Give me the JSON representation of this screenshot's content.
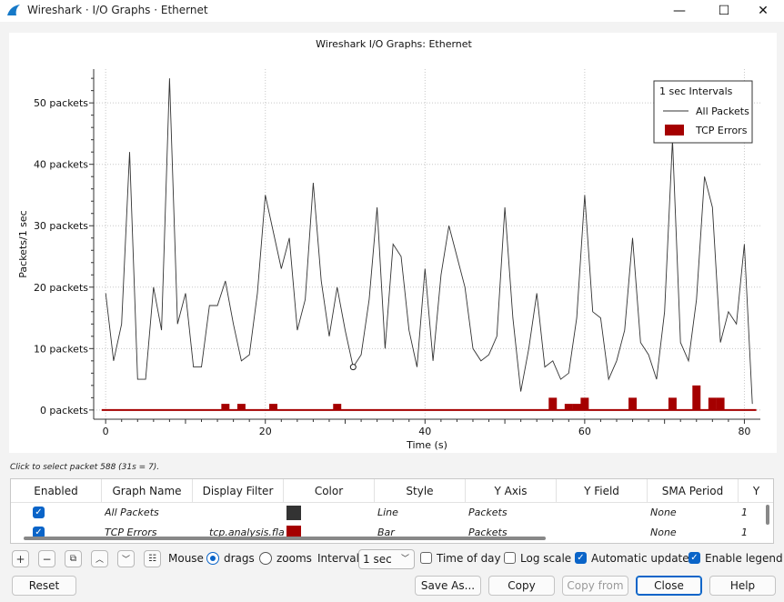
{
  "window": {
    "title": "Wireshark · I/O Graphs · Ethernet",
    "minimize": "—",
    "maximize": "☐",
    "close": "✕"
  },
  "chart_data": {
    "type": "line",
    "title": "Wireshark I/O Graphs: Ethernet",
    "xlabel": "Time (s)",
    "ylabel": "Packets/1 sec",
    "xlim": [
      -1.5,
      82
    ],
    "ylim": [
      -1.5,
      55.5
    ],
    "xticks": [
      0,
      20,
      40,
      60,
      80
    ],
    "xtick_labels": [
      "0",
      "20",
      "40",
      "60",
      "80"
    ],
    "yticks": [
      0,
      10,
      20,
      30,
      40,
      50
    ],
    "ytick_labels": [
      "0 packets",
      "10 packets",
      "20 packets",
      "30 packets",
      "40 packets",
      "50 packets"
    ],
    "grid": true,
    "legend": {
      "header": "1 sec Intervals",
      "placement": "top-right"
    },
    "series": [
      {
        "name": "All Packets",
        "style": "line",
        "color": "#333333",
        "x": [
          0,
          1,
          2,
          3,
          4,
          5,
          6,
          7,
          8,
          9,
          10,
          11,
          12,
          13,
          14,
          15,
          16,
          17,
          18,
          19,
          20,
          21,
          22,
          23,
          24,
          25,
          26,
          27,
          28,
          29,
          30,
          31,
          32,
          33,
          34,
          35,
          36,
          37,
          38,
          39,
          40,
          41,
          42,
          43,
          44,
          45,
          46,
          47,
          48,
          49,
          50,
          51,
          52,
          53,
          54,
          55,
          56,
          57,
          58,
          59,
          60,
          61,
          62,
          63,
          64,
          65,
          66,
          67,
          68,
          69,
          70,
          71,
          72,
          73,
          74,
          75,
          76,
          77,
          78,
          79,
          80,
          81
        ],
        "y": [
          19,
          8,
          14,
          42,
          5,
          5,
          20,
          13,
          54,
          14,
          19,
          7,
          7,
          17,
          17,
          21,
          14,
          8,
          9,
          19,
          35,
          29,
          23,
          28,
          13,
          18,
          37,
          21,
          12,
          20,
          13,
          7,
          9,
          18,
          33,
          10,
          27,
          25,
          13,
          7,
          23,
          8,
          22,
          30,
          25,
          20,
          10,
          8,
          9,
          12,
          33,
          15,
          3,
          10,
          19,
          7,
          8,
          5,
          6,
          15,
          35,
          16,
          15,
          5,
          8,
          13,
          28,
          11,
          9,
          5,
          16,
          44,
          11,
          8,
          18,
          38,
          33,
          11,
          16,
          14,
          27,
          1
        ]
      },
      {
        "name": "TCP Errors",
        "style": "bar",
        "color": "#a50000",
        "x": [
          15,
          17,
          21,
          29,
          56,
          58,
          59,
          60,
          66,
          71,
          74,
          76,
          77
        ],
        "y": [
          1,
          1,
          1,
          1,
          2,
          1,
          1,
          2,
          2,
          2,
          4,
          2,
          2
        ]
      }
    ],
    "hover_marker": {
      "x": 31,
      "y": 7
    }
  },
  "status": "Click to select packet 588 (31s = 7).",
  "table": {
    "headers": [
      "Enabled",
      "Graph Name",
      "Display Filter",
      "Color",
      "Style",
      "Y Axis",
      "Y Field",
      "SMA Period",
      "Y"
    ],
    "rows": [
      {
        "enabled": true,
        "name": "All Packets",
        "filter": "",
        "color": "#333333",
        "style": "Line",
        "yaxis": "Packets",
        "yfield": "",
        "sma": "None",
        "y": "1"
      },
      {
        "enabled": true,
        "name": "TCP Errors",
        "filter": "tcp.analysis.flags",
        "color": "#a50000",
        "style": "Bar",
        "yaxis": "Packets",
        "yfield": "",
        "sma": "None",
        "y": "1"
      }
    ]
  },
  "toolbar": {
    "mouse_label": "Mouse",
    "drags_label": "drags",
    "zooms_label": "zooms",
    "interval_label": "Interval",
    "interval_value": "1 sec",
    "time_of_day_label": "Time of day",
    "log_scale_label": "Log scale",
    "auto_update_label": "Automatic update",
    "enable_legend_label": "Enable legend"
  },
  "buttons": {
    "reset": "Reset",
    "save_as": "Save As...",
    "copy": "Copy",
    "copy_from": "Copy from",
    "close": "Close",
    "help": "Help"
  }
}
